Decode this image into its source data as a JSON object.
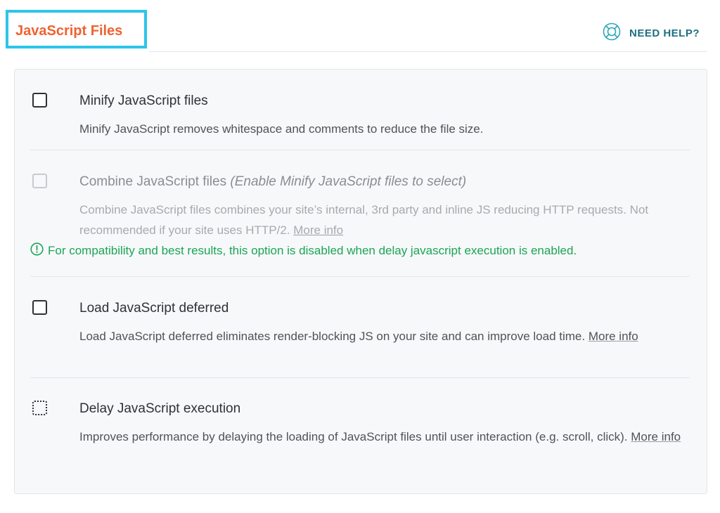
{
  "header": {
    "title": "JavaScript Files",
    "help_label": "NEED HELP?"
  },
  "colors": {
    "title": "#f0622f",
    "highlight_box": "#2cc5e8",
    "help": "#1e6f81",
    "notice": "#1aa556"
  },
  "options": [
    {
      "title": "Minify JavaScript files",
      "description": "Minify JavaScript removes whitespace and comments to reduce the file size.",
      "checked": false,
      "disabled": false
    },
    {
      "title": "Combine JavaScript files",
      "title_note": "(Enable Minify JavaScript files to select)",
      "description": "Combine JavaScript files combines your site’s internal, 3rd party and inline JS reducing HTTP requests. Not recommended if your site uses HTTP/2.",
      "more_info": "More info",
      "notice": "For compatibility and best results, this option is disabled when delay javascript execution is enabled.",
      "checked": false,
      "disabled": true
    },
    {
      "title": "Load JavaScript deferred",
      "description": "Load JavaScript deferred eliminates render-blocking JS on your site and can improve load time.",
      "more_info": "More info",
      "checked": false,
      "disabled": false
    },
    {
      "title": "Delay JavaScript execution",
      "description": "Improves performance by delaying the loading of JavaScript files until user interaction (e.g. scroll, click).",
      "more_info": "More info",
      "checked": false,
      "disabled": false
    }
  ],
  "icons": {
    "help": "lifebuoy-icon",
    "notice": "info-circle-icon"
  }
}
